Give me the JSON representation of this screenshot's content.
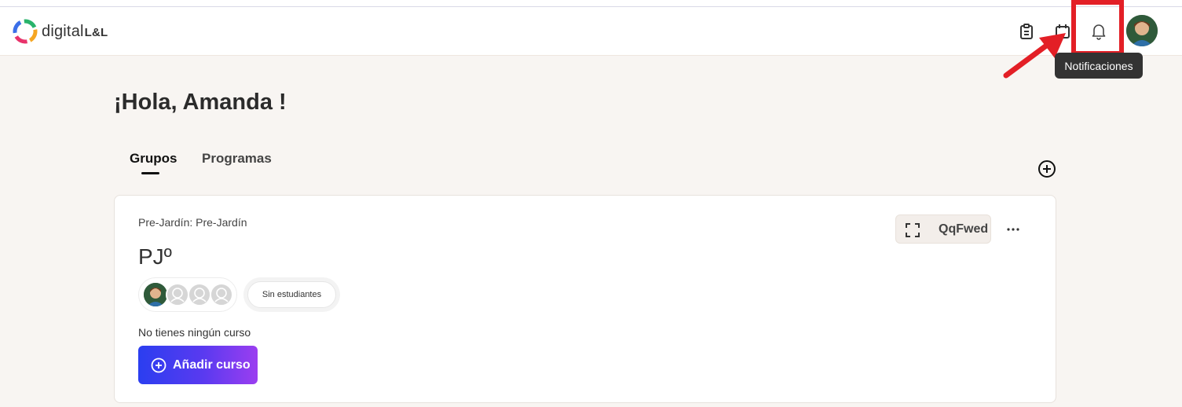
{
  "header": {
    "logo_text": "digital",
    "logo_suffix": "L&L",
    "notifications_tooltip": "Notificaciones"
  },
  "page": {
    "greeting": "¡Hola, Amanda !"
  },
  "tabs": [
    {
      "label": "Grupos",
      "active": true
    },
    {
      "label": "Programas",
      "active": false
    }
  ],
  "group_card": {
    "subtitle": "Pre-Jardín: Pre-Jardín",
    "title": "PJº",
    "join_code": "QqFwed",
    "students_label": "Sin estudiantes",
    "no_course_text": "No tienes ningún curso",
    "add_course_label": "Añadir curso"
  },
  "colors": {
    "highlight": "#e31f26",
    "button_gradient_start": "#2b3ef0",
    "button_gradient_end": "#9b3ef0",
    "background": "#f8f5f2"
  }
}
